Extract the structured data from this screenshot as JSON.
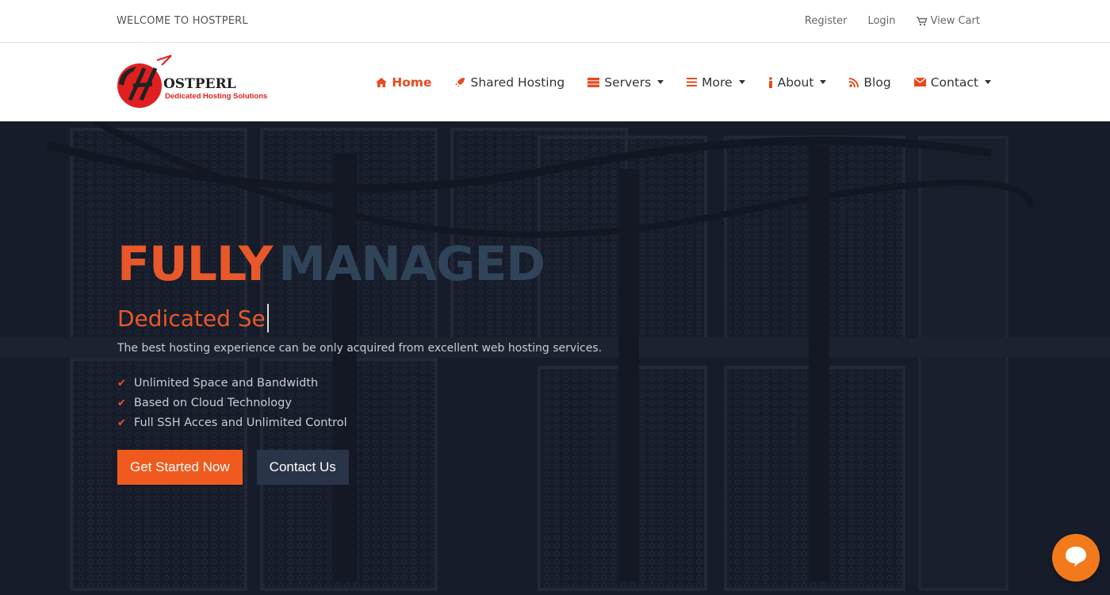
{
  "topbar": {
    "welcome": "WELCOME TO HOSTPERL",
    "links": {
      "register": "Register",
      "login": "Login",
      "cart": "View Cart"
    }
  },
  "logo": {
    "name": "OSTPERL",
    "tagline": "Dedicated Hosting Solutions"
  },
  "nav": {
    "items": [
      {
        "label": "Home",
        "icon": "home-icon"
      },
      {
        "label": "Shared Hosting",
        "icon": "rocket-icon"
      },
      {
        "label": "Servers",
        "icon": "server-icon",
        "dropdown": true
      },
      {
        "label": "More",
        "icon": "menu-icon",
        "dropdown": true
      },
      {
        "label": "About",
        "icon": "info-icon",
        "dropdown": true
      },
      {
        "label": "Blog",
        "icon": "rss-icon"
      },
      {
        "label": "Contact",
        "icon": "envelope-icon",
        "dropdown": true
      }
    ]
  },
  "hero": {
    "headline_1": "FULLY",
    "headline_2": "MANAGED",
    "typed": "Dedicated Se",
    "lead": "The best hosting experience can be only acquired from excellent web hosting services.",
    "features": [
      "Unlimited Space and Bandwidth",
      "Based on Cloud Technology",
      "Full SSH Acces and Unlimited Control"
    ],
    "cta_primary": "Get Started Now",
    "cta_secondary": "Contact Us"
  },
  "colors": {
    "accent": "#e8582a",
    "dark": "#1d2331",
    "button_secondary": "#2a3448"
  },
  "chat": {
    "icon": "chat-icon"
  }
}
